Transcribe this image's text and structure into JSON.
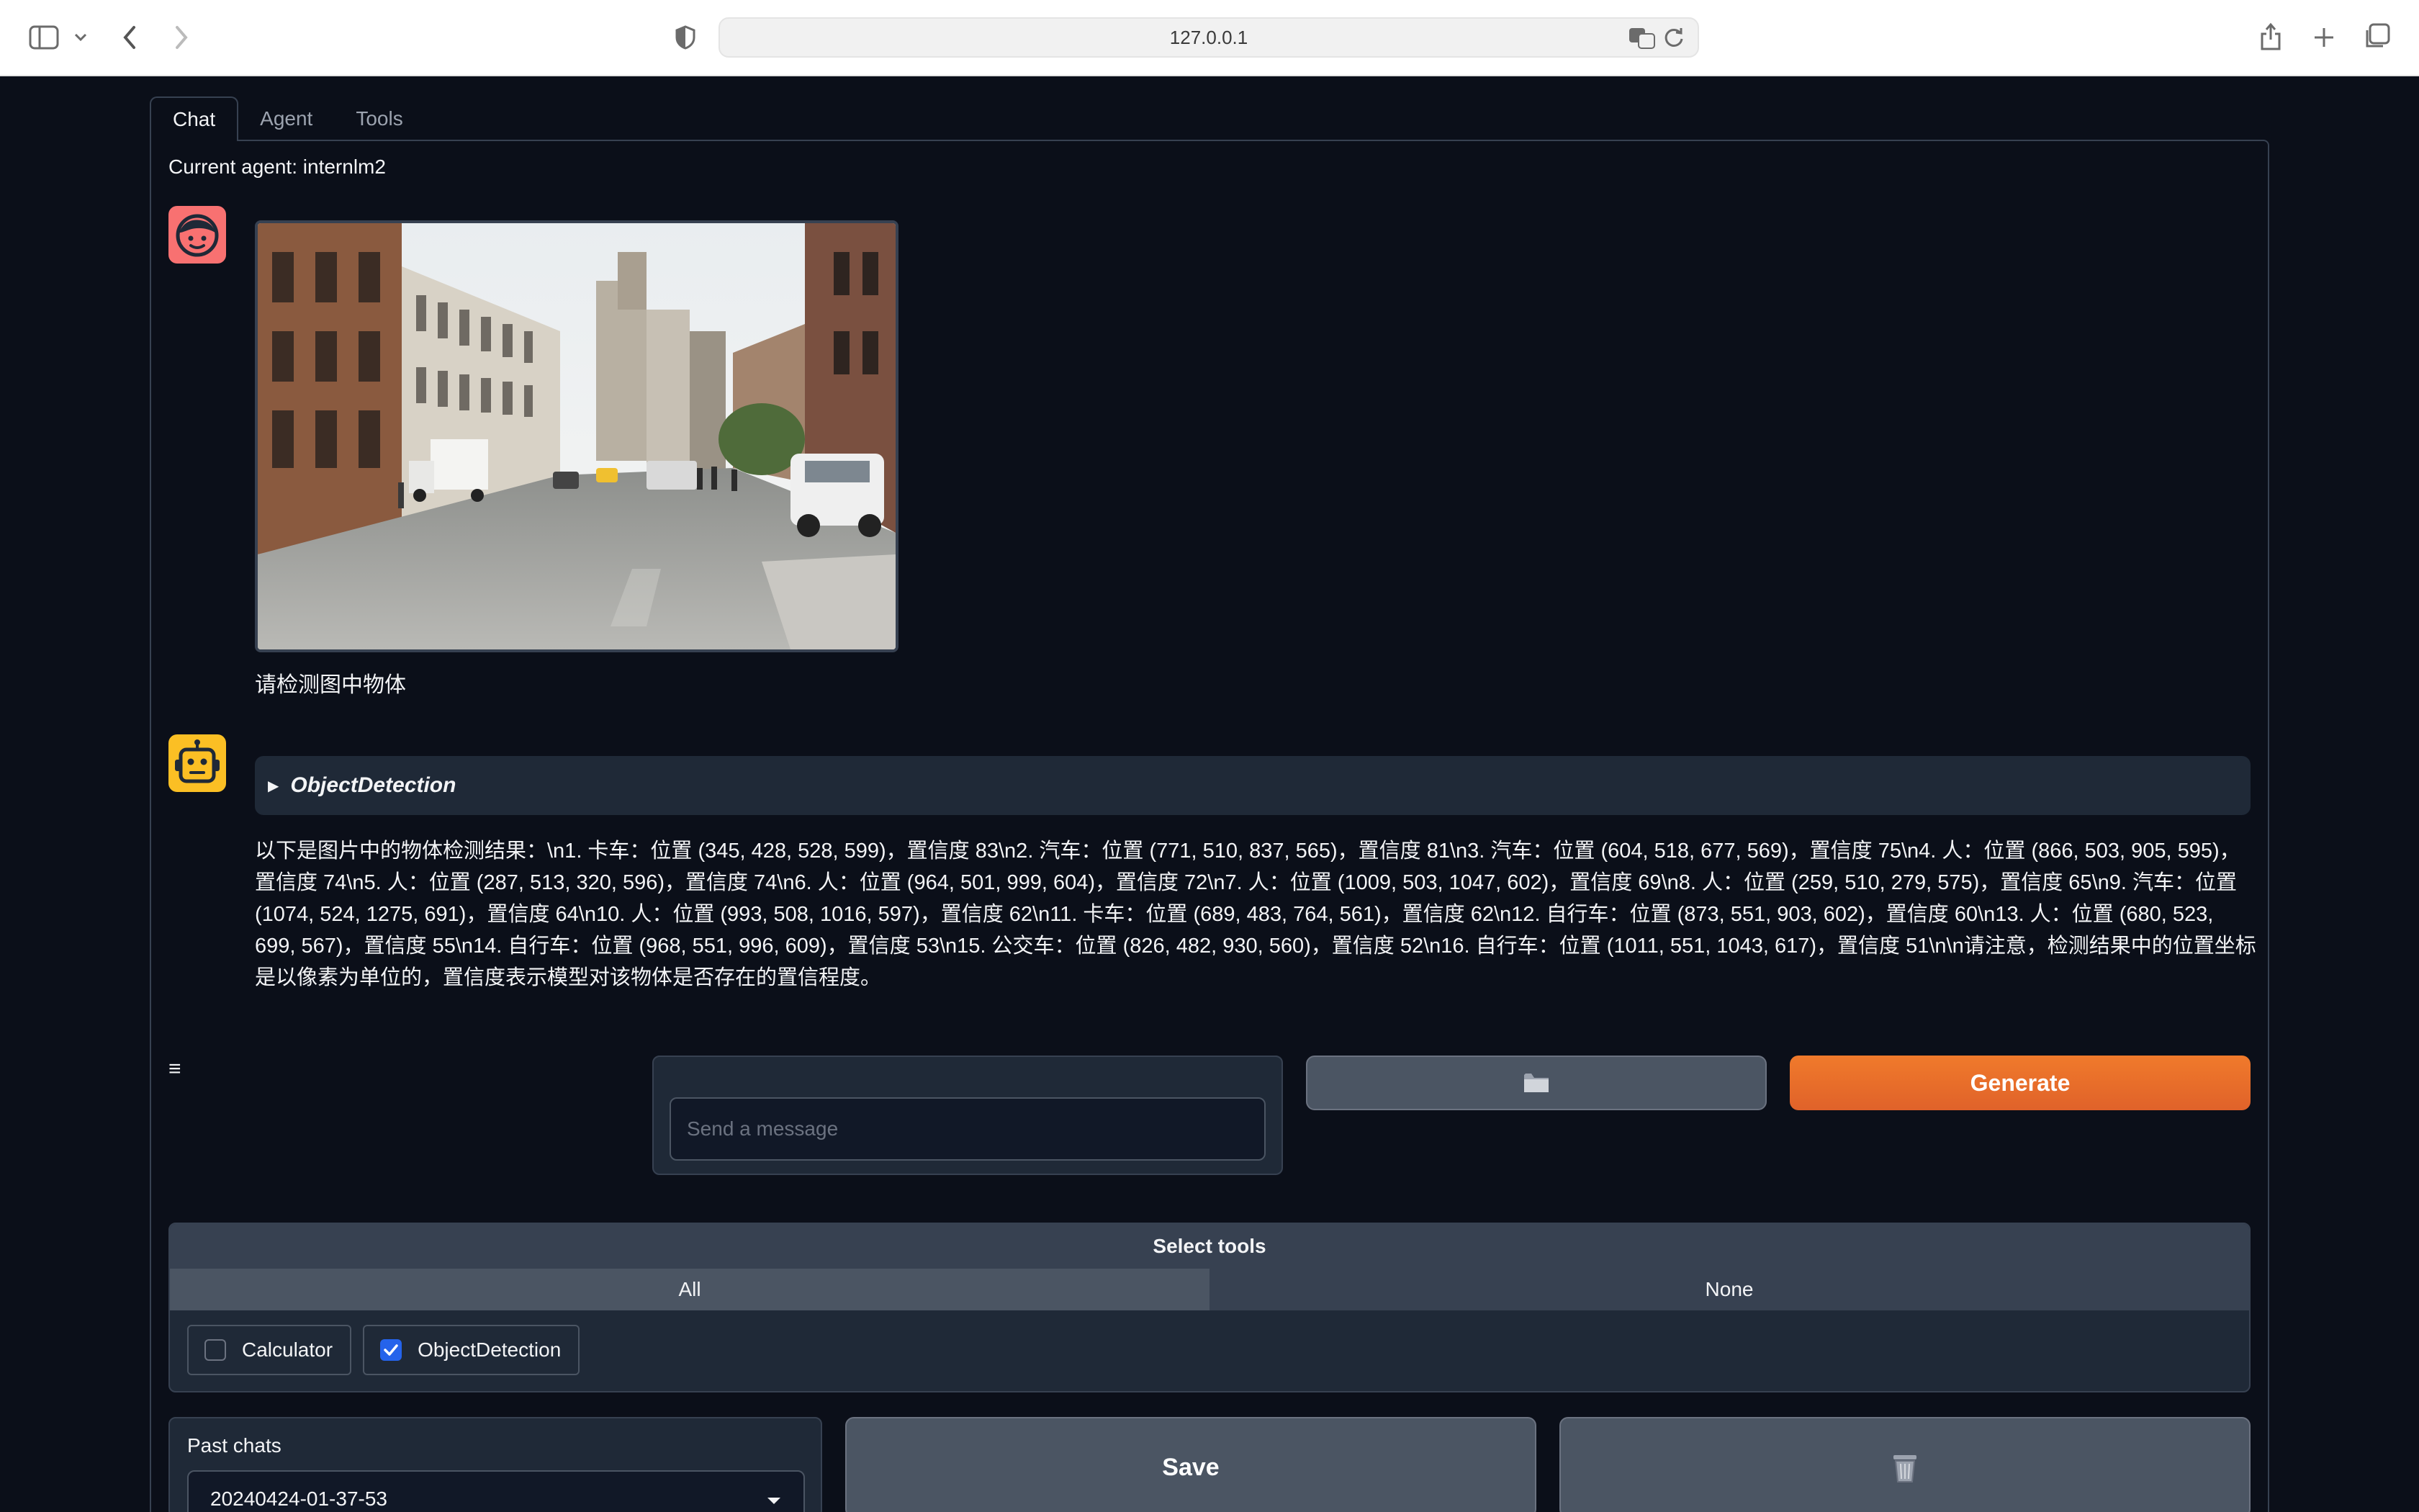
{
  "browser": {
    "url": "127.0.0.1"
  },
  "tabs": [
    "Chat",
    "Agent",
    "Tools"
  ],
  "active_tab": "Chat",
  "current_agent": "Current agent: internlm2",
  "chat": {
    "user_message": "请检测图中物体",
    "tool_call_title": "ObjectDetection",
    "bot_message": "以下是图片中的物体检测结果：\\n1. 卡车：位置 (345, 428, 528, 599)，置信度 83\\n2. 汽车：位置 (771, 510, 837, 565)，置信度 81\\n3. 汽车：位置 (604, 518, 677, 569)，置信度 75\\n4. 人：位置 (866, 503, 905, 595)，置信度 74\\n5. 人：位置 (287, 513, 320, 596)，置信度 74\\n6. 人：位置 (964, 501, 999, 604)，置信度 72\\n7. 人：位置 (1009, 503, 1047, 602)，置信度 69\\n8. 人：位置 (259, 510, 279, 575)，置信度 65\\n9. 汽车：位置 (1074, 524, 1275, 691)，置信度 64\\n10. 人：位置 (993, 508, 1016, 597)，置信度 62\\n11. 卡车：位置 (689, 483, 764, 561)，置信度 62\\n12. 自行车：位置 (873, 551, 903, 602)，置信度 60\\n13. 人：位置 (680, 523, 699, 567)，置信度 55\\n14. 自行车：位置 (968, 551, 996, 609)，置信度 53\\n15. 公交车：位置 (826, 482, 930, 560)，置信度 52\\n16. 自行车：位置 (1011, 551, 1043, 617)，置信度 51\\n\\n请注意，检测结果中的位置坐标是以像素为单位的，置信度表示模型对该物体是否存在的置信程度。"
  },
  "composer": {
    "menu_icon": "≡",
    "placeholder": "Send a message",
    "generate_label": "Generate"
  },
  "tools": {
    "header": "Select tools",
    "all_label": "All",
    "none_label": "None",
    "items": [
      {
        "label": "Calculator",
        "checked": false
      },
      {
        "label": "ObjectDetection",
        "checked": true
      }
    ]
  },
  "history": {
    "label": "Past chats",
    "selected": "20240424-01-37-53",
    "save_label": "Save"
  },
  "colors": {
    "background": "#0b0f19",
    "panel": "#1f2937",
    "accent": "#e8702a",
    "checkbox": "#2563eb",
    "user_avatar": "#f87171",
    "bot_avatar": "#fbbf24"
  }
}
